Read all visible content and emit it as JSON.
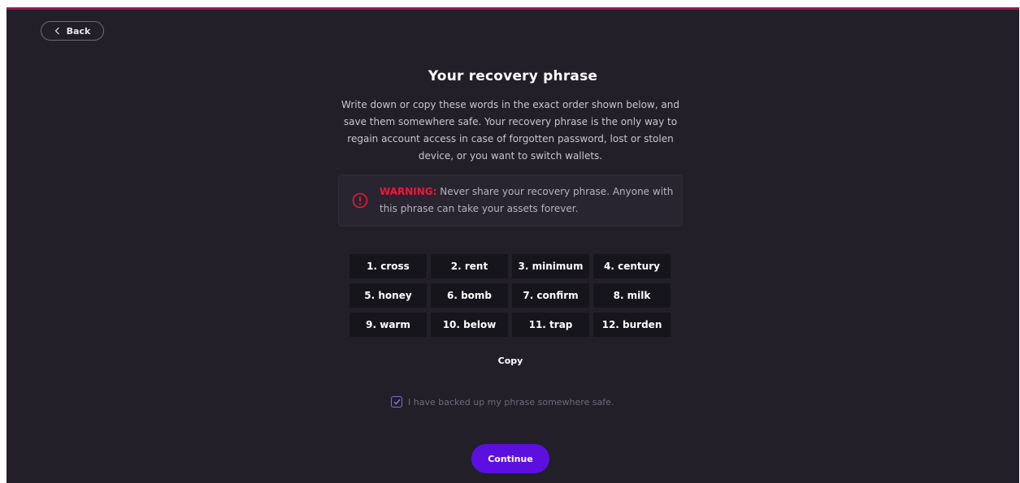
{
  "header": {
    "back_label": "Back"
  },
  "main": {
    "title": "Your recovery phrase",
    "description": "Write down or copy these words in the exact order shown below, and save them somewhere safe. Your recovery phrase is the only way to regain account access in case of forgotten password, lost or stolen device, or you want to switch wallets.",
    "warning": {
      "label": "WARNING:",
      "text": " Never share your recovery phrase. Anyone with this phrase can take your assets forever."
    },
    "words": [
      "1. cross",
      "2. rent",
      "3. minimum",
      "4. century",
      "5. honey",
      "6. bomb",
      "7. confirm",
      "8. milk",
      "9. warm",
      "10. below",
      "11. trap",
      "12. burden"
    ],
    "copy_label": "Copy",
    "checkbox": {
      "label": "I have backed up my phrase somewhere safe.",
      "checked": true
    },
    "continue_label": "Continue"
  },
  "colors": {
    "accent": "#5b10e0",
    "warning": "#f0163d",
    "top_border": "#8e1d54",
    "background": "#221f29"
  }
}
